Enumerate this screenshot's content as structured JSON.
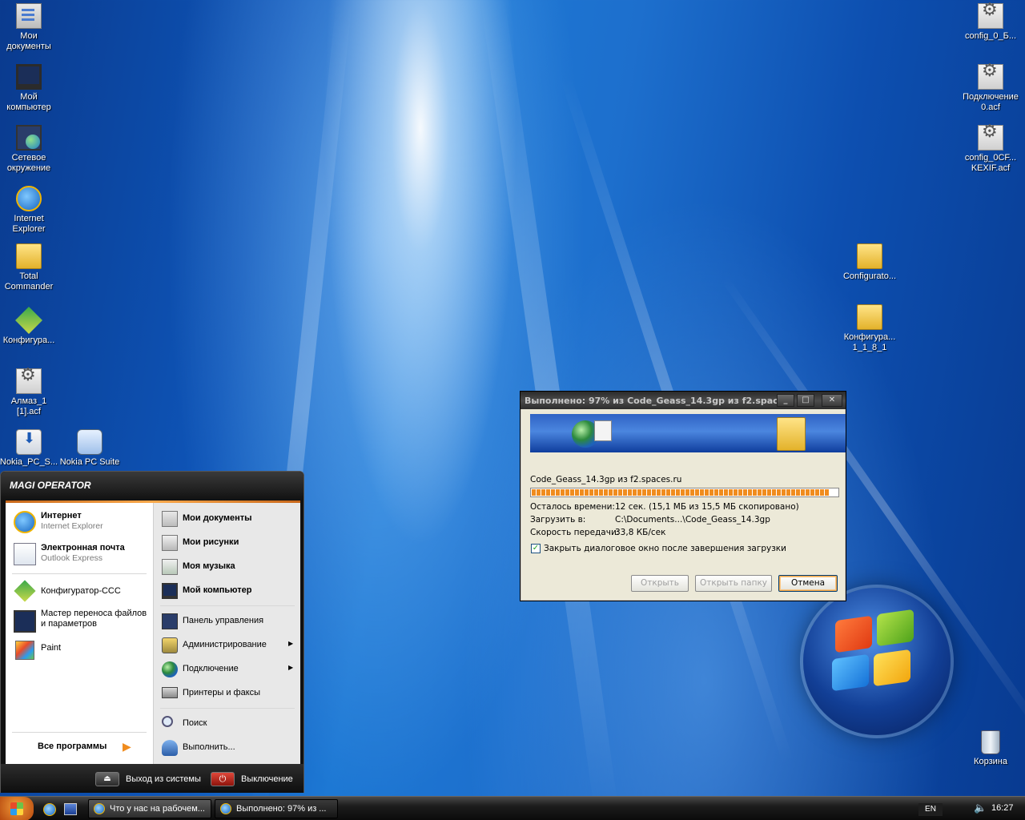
{
  "desktop": {
    "icons_left": [
      {
        "label": "Мои документы",
        "icon": "my-documents-icon"
      },
      {
        "label": "Мой компьютер",
        "icon": "my-computer-icon"
      },
      {
        "label": "Сетевое окружение",
        "icon": "network-places-icon"
      },
      {
        "label": "Internet Explorer",
        "icon": "internet-explorer-icon"
      },
      {
        "label": "Total Commander",
        "icon": "folder-icon"
      },
      {
        "label": "Конфигура...",
        "icon": "configurator-icon"
      },
      {
        "label": "Алмаз_1 [1].acf",
        "icon": "config-file-icon"
      },
      {
        "label": "Nokia_PC_S...",
        "icon": "nokia-installer-icon"
      },
      {
        "label": "Nokia PC Suite",
        "icon": "nokia-pc-suite-icon"
      }
    ],
    "icons_right": [
      {
        "label": "config_0_Б...",
        "icon": "config-file-icon"
      },
      {
        "label": "Подключение 0.acf",
        "icon": "config-file-icon"
      },
      {
        "label": "config_0CF... KEXIF.acf",
        "icon": "config-file-icon"
      },
      {
        "label": "Configurato...",
        "icon": "folder-icon"
      },
      {
        "label": "Конфигура... 1_1_8_1",
        "icon": "folder-icon"
      },
      {
        "label": "Корзина",
        "icon": "recycle-bin-icon"
      }
    ]
  },
  "download_dialog": {
    "title": "Выполнено: 97% из Code_Geass_14.3gp из f2.spac...",
    "file_line": "Code_Geass_14.3gp из f2.spaces.ru",
    "progress": 0.97,
    "time_left_label": "Осталось времени:",
    "time_left_value": "12 сек. (15,1 МБ из 15,5 МБ скопировано)",
    "download_to_label": "Загрузить в:",
    "download_to_value": "C:\\Documents...\\Code_Geass_14.3gp",
    "speed_label": "Скорость передачи:",
    "speed_value": "33,8 КБ/сек",
    "close_checkbox_label": "Закрыть диалоговое окно после завершения загрузки",
    "close_checkbox_checked": true,
    "btn_open": "Открыть",
    "btn_open_folder": "Открыть папку",
    "btn_cancel": "Отмена"
  },
  "start_menu": {
    "user": "MAGI OPERATOR",
    "pinned": [
      {
        "title": "Интернет",
        "sub": "Internet Explorer"
      },
      {
        "title": "Электронная почта",
        "sub": "Outlook Express"
      }
    ],
    "recent": [
      {
        "title": "Конфигуратор-CCC"
      },
      {
        "title": "Мастер переноса файлов",
        "title2": "и параметров"
      },
      {
        "title": "Paint"
      }
    ],
    "all_programs": "Все программы",
    "right": [
      {
        "label": "Мои документы",
        "bold": true
      },
      {
        "label": "Мои рисунки",
        "bold": true
      },
      {
        "label": "Моя музыка",
        "bold": true
      },
      {
        "label": "Мой компьютер",
        "bold": true
      },
      {
        "label": "Панель управления"
      },
      {
        "label": "Администрирование",
        "arrow": true
      },
      {
        "label": "Подключение",
        "arrow": true
      },
      {
        "label": "Принтеры и факсы"
      },
      {
        "label": "Поиск"
      },
      {
        "label": "Выполнить..."
      }
    ],
    "logoff": "Выход из системы",
    "shutdown": "Выключение"
  },
  "taskbar": {
    "tasks": [
      {
        "label": "Что у нас на рабочем..."
      },
      {
        "label": "Выполнено: 97% из ..."
      }
    ],
    "language": "EN",
    "clock": "16:27"
  },
  "colors": {
    "accent_orange": "#f08c1e",
    "desktop_blue": "#0e55b8"
  }
}
